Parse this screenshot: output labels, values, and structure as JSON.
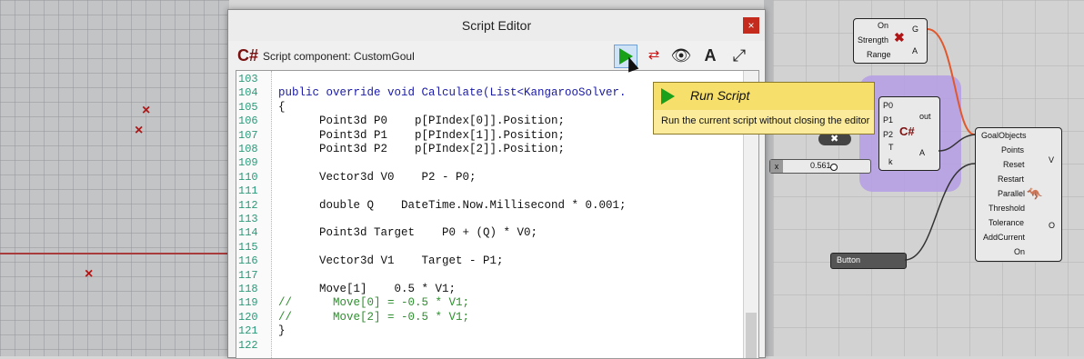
{
  "viewport": {
    "points": [
      "×",
      "×",
      "×"
    ]
  },
  "editor": {
    "title": "Script Editor",
    "close_label": "×",
    "logo_text": "C#",
    "component_label": "Script component: CustomGoul",
    "toolbar": {
      "run": "run-icon",
      "eye_label": "👁",
      "font_label": "A",
      "fit_label": "⤢"
    }
  },
  "code": {
    "lines": [
      {
        "n": "103",
        "text": ""
      },
      {
        "n": "104",
        "text": "public override void Calculate(List<KangarooSolver."
      },
      {
        "n": "105",
        "text": "{"
      },
      {
        "n": "106",
        "text": "      Point3d P0    p[PIndex[0]].Position;"
      },
      {
        "n": "107",
        "text": "      Point3d P1    p[PIndex[1]].Position;"
      },
      {
        "n": "108",
        "text": "      Point3d P2    p[PIndex[2]].Position;"
      },
      {
        "n": "109",
        "text": ""
      },
      {
        "n": "110",
        "text": "      Vector3d V0    P2 - P0;"
      },
      {
        "n": "111",
        "text": ""
      },
      {
        "n": "112",
        "text": "      double Q    DateTime.Now.Millisecond * 0.001;"
      },
      {
        "n": "113",
        "text": ""
      },
      {
        "n": "114",
        "text": "      Point3d Target    P0 + (Q) * V0;"
      },
      {
        "n": "115",
        "text": ""
      },
      {
        "n": "116",
        "text": "      Vector3d V1    Target - P1;"
      },
      {
        "n": "117",
        "text": ""
      },
      {
        "n": "118",
        "text": "      Move[1]    0.5 * V1;"
      },
      {
        "n": "119",
        "text": "//      Move[0] = -0.5 * V1;"
      },
      {
        "n": "120",
        "text": "//      Move[2] = -0.5 * V1;"
      },
      {
        "n": "121",
        "text": "}"
      },
      {
        "n": "122",
        "text": ""
      }
    ]
  },
  "tooltip": {
    "title": "Run Script",
    "description": "Run the current script without closing the editor"
  },
  "gh": {
    "top_component": {
      "inputs": [
        "On",
        "Strength",
        "Range"
      ],
      "outputs": [
        "G",
        "A"
      ]
    },
    "script_component": {
      "inputs": [
        "P0",
        "P1",
        "P2",
        "T",
        "k"
      ],
      "outputs": [
        "out",
        "A"
      ]
    },
    "slider": {
      "label": "x",
      "value": "0.561"
    },
    "button": {
      "label": "Button"
    },
    "solver": {
      "inputs": [
        "GoalObjects",
        "Points",
        "Reset",
        "Restart",
        "Parallel",
        "Threshold",
        "Tolerance",
        "AddCurrent",
        "On"
      ],
      "outputs": [
        "V",
        "O"
      ]
    }
  },
  "colors": {
    "accent_red": "#b11414",
    "play_green": "#19a019",
    "tooltip_bg": "#fbeb9a",
    "group_purple": "#b69de6"
  }
}
